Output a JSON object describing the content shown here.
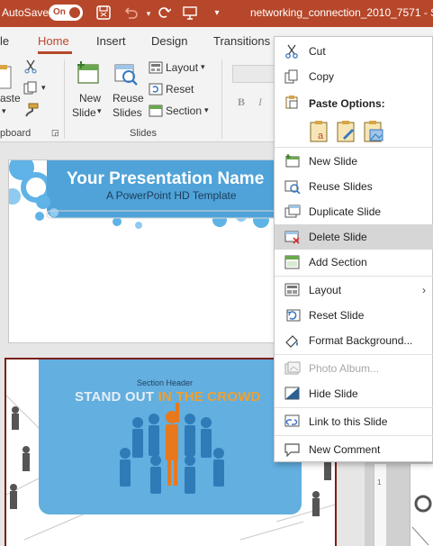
{
  "titlebar": {
    "autosave_label": "AutoSave",
    "toggle_label": "On",
    "filename": "networking_connection_2010_7571  -  S"
  },
  "tabs": [
    "le",
    "Home",
    "Insert",
    "Design",
    "Transitions"
  ],
  "ribbon": {
    "clipboard": {
      "paste_label": "aste",
      "group_label": "pboard"
    },
    "slides": {
      "new_slide_line1": "New",
      "new_slide_line2": "Slide",
      "reuse_line1": "Reuse",
      "reuse_line2": "Slides",
      "layout": "Layout",
      "reset": "Reset",
      "section": "Section",
      "group_label": "Slides"
    },
    "font": {
      "bold": "B",
      "italic": "I"
    }
  },
  "slide1": {
    "title": "Your Presentation Name",
    "subtitle": "A PowerPoint HD Template"
  },
  "slide2": {
    "section_header": "Section Header",
    "title_part1": "STAND OUT ",
    "title_part2": "IN THE CROWD"
  },
  "context_menu": {
    "cut": "Cut",
    "copy": "Copy",
    "paste_options": "Paste Options:",
    "new_slide": "New Slide",
    "reuse_slides": "Reuse Slides",
    "duplicate_slide": "Duplicate Slide",
    "delete_slide": "Delete Slide",
    "add_section": "Add Section",
    "layout": "Layout",
    "reset_slide": "Reset Slide",
    "format_background": "Format Background...",
    "photo_album": "Photo Album...",
    "hide_slide": "Hide Slide",
    "link_to_slide": "Link to this Slide",
    "new_comment": "New Comment"
  },
  "colors": {
    "accent": "#b7472a",
    "menu_hover": "#d6d6d6",
    "slide_blue": "#4fa3d8"
  }
}
